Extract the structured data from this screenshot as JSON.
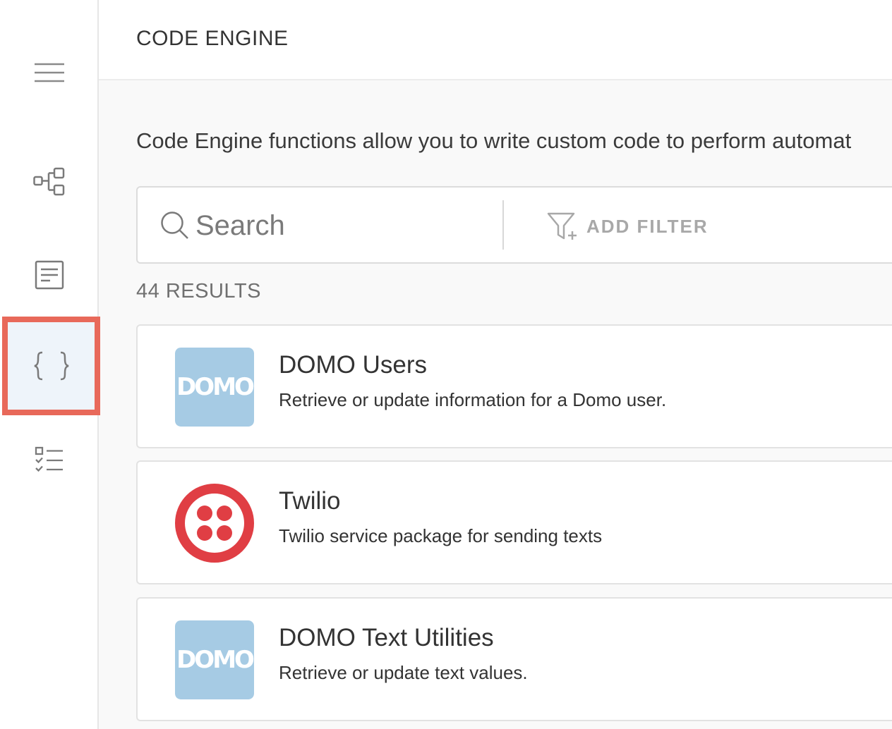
{
  "sidebar": {
    "items": [
      {
        "name": "menu",
        "icon": "hamburger-menu-icon"
      },
      {
        "name": "workflows",
        "icon": "workflow-diagram-icon"
      },
      {
        "name": "documents",
        "icon": "document-icon"
      },
      {
        "name": "code-engine",
        "icon": "curly-braces-icon",
        "active": true
      },
      {
        "name": "tasks",
        "icon": "checklist-icon"
      }
    ],
    "active_border_color": "#e8695a",
    "active_bg_color": "#eef4fa"
  },
  "header": {
    "title": "CODE ENGINE"
  },
  "main": {
    "description": "Code Engine functions allow you to write custom code to perform automat",
    "search": {
      "placeholder": "Search",
      "value": ""
    },
    "filter": {
      "label": "ADD FILTER"
    },
    "results_count": "44 RESULTS",
    "packages": [
      {
        "title": "DOMO Users",
        "description": "Retrieve or update information for a Domo user.",
        "logo": "DOMO",
        "logo_type": "domo-logo"
      },
      {
        "title": "Twilio",
        "description": "Twilio service package for sending texts",
        "logo_type": "twilio-logo"
      },
      {
        "title": "DOMO Text Utilities",
        "description": "Retrieve or update text values.",
        "logo": "DOMO",
        "logo_type": "domo-logo"
      }
    ]
  },
  "colors": {
    "domo_blue": "#a6cbe4",
    "twilio_red": "#e03e44"
  }
}
